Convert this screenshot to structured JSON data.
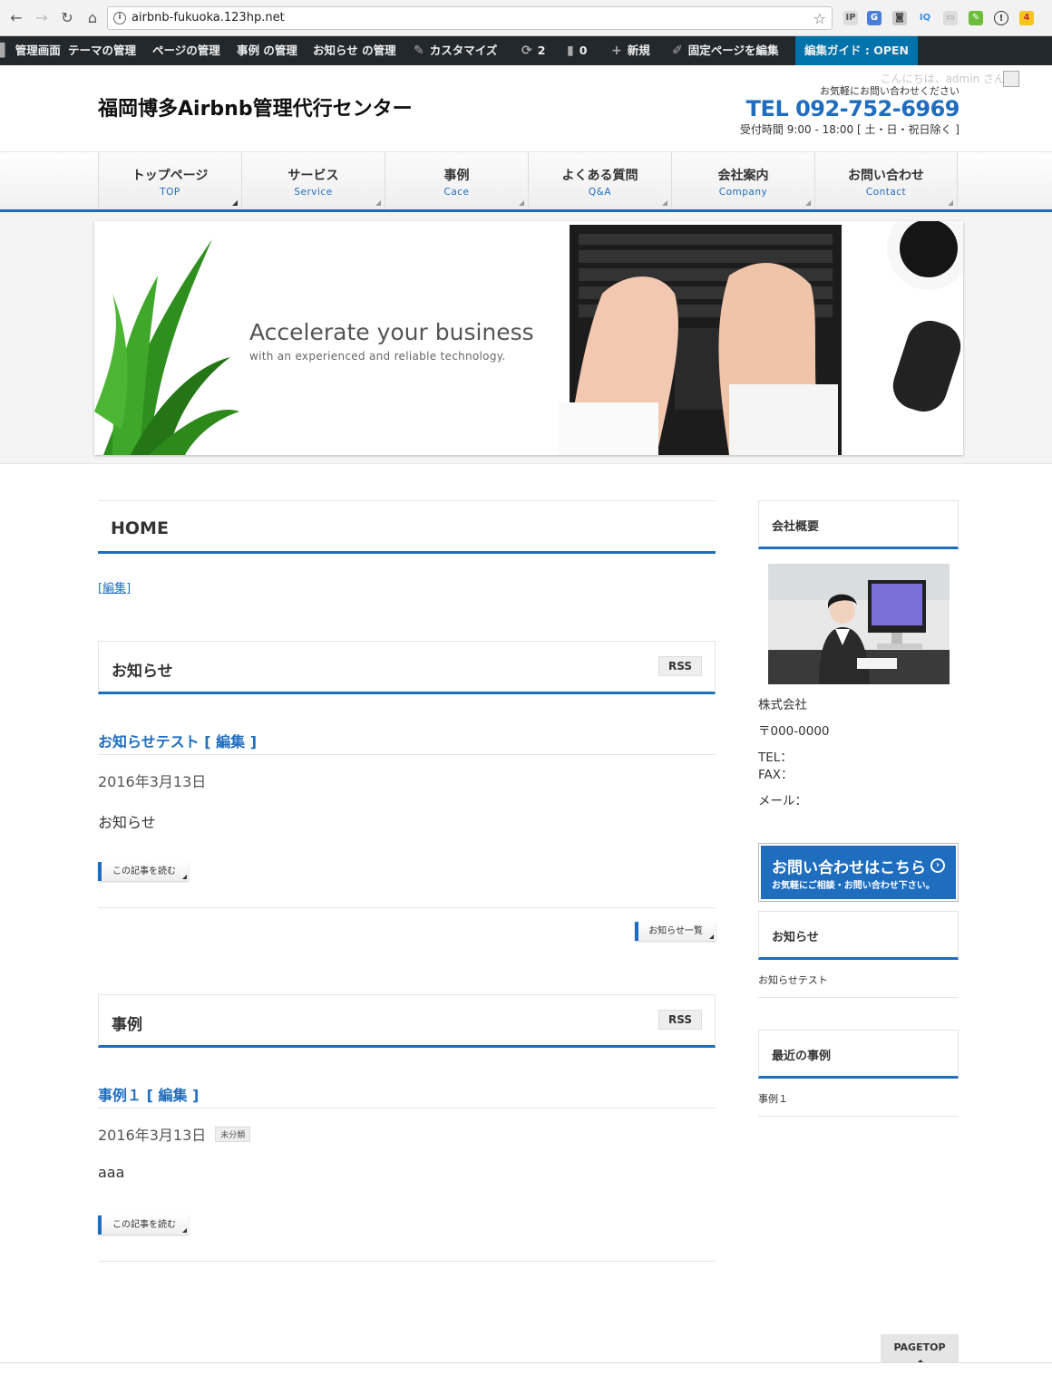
{
  "browser": {
    "url": "airbnb-fukuoka.123hp.net"
  },
  "adminbar": {
    "items": [
      {
        "label": "管理画面",
        "icon": "dashboard-icon"
      },
      {
        "label": "テーマの管理"
      },
      {
        "label": "ページの管理"
      },
      {
        "label": "事例 の管理"
      },
      {
        "label": "お知らせ の管理"
      },
      {
        "label": "カスタマイズ",
        "icon": "brush-icon"
      },
      {
        "label": "2",
        "icon": "update-icon"
      },
      {
        "label": "0",
        "icon": "comment-icon"
      },
      {
        "label": "新規",
        "icon": "plus-icon"
      },
      {
        "label": "固定ページを編集",
        "icon": "pencil-icon"
      },
      {
        "label": "編集ガイド : OPEN"
      }
    ],
    "greeting": "こんにちは、admin さん！"
  },
  "header": {
    "site_title": "福岡博多Airbnb管理代行センター",
    "contact_small": "お気軽にお問い合わせください",
    "tel": "TEL 092-752-6969",
    "hours": "受付時間 9:00 - 18:00 [ 土・日・祝日除く ]"
  },
  "nav": [
    {
      "jp": "トップページ",
      "en": "TOP"
    },
    {
      "jp": "サービス",
      "en": "Service"
    },
    {
      "jp": "事例",
      "en": "Cace"
    },
    {
      "jp": "よくある質問",
      "en": "Q&A"
    },
    {
      "jp": "会社案内",
      "en": "Company"
    },
    {
      "jp": "お問い合わせ",
      "en": "Contact"
    }
  ],
  "hero": {
    "title": "Accelerate your business",
    "subtitle": "with an experienced and reliable technology."
  },
  "main": {
    "page_title": "HOME",
    "edit_link": "[編集]",
    "news": {
      "heading": "お知らせ",
      "rss": "RSS",
      "post_title": "お知らせテスト [ 編集 ]",
      "date": "2016年3月13日",
      "body": "お知らせ",
      "read_more": "この記事を読む",
      "list_link": "お知らせ一覧"
    },
    "cases": {
      "heading": "事例",
      "rss": "RSS",
      "post_title": "事例１ [ 編集 ]",
      "date": "2016年3月13日",
      "category": "未分類",
      "body": "aaa",
      "read_more": "この記事を読む"
    }
  },
  "sidebar": {
    "company": {
      "heading": "会社概要",
      "name": "株式会社",
      "zip": "〒000-0000",
      "tel": "TEL：",
      "fax": "FAX：",
      "mail": "メール："
    },
    "cta": {
      "main": "お問い合わせはこちら",
      "sub": "お気軽にご相談・お問い合わせ下さい。"
    },
    "news": {
      "heading": "お知らせ",
      "item": "お知らせテスト"
    },
    "cases": {
      "heading": "最近の事例",
      "item": "事例１"
    }
  },
  "footer": {
    "pagetop": "PAGETOP"
  },
  "colors": {
    "accent": "#1e6dbf",
    "adminbar": "#23282d"
  }
}
